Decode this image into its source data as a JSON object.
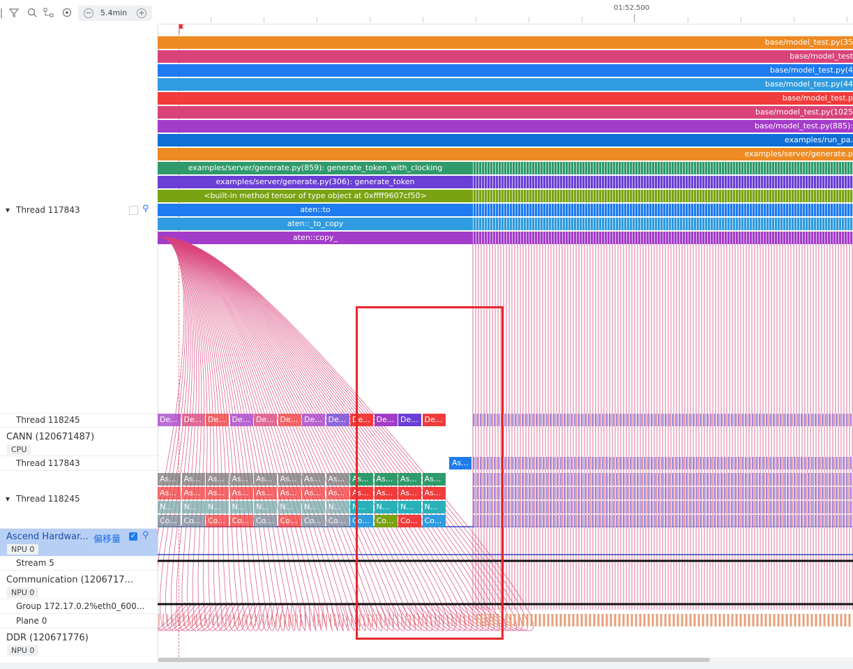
{
  "toolbar": {
    "zoom_value": "5.4min",
    "icons": [
      "filter-icon",
      "search-icon",
      "flow-icon",
      "target-icon"
    ]
  },
  "ruler": {
    "time_label": "01:52.500"
  },
  "rows": {
    "thread_117843": "Thread 117843",
    "thread_118245_a": "Thread 118245",
    "cann": "CANN (120671487)",
    "cann_badge": "CPU",
    "thread_117843_b": "Thread 117843",
    "thread_118245_b": "Thread 118245",
    "ascend": "Ascend Hardwar...",
    "ascend_offset": "偏移量",
    "ascend_badge": "NPU 0",
    "stream": "Stream 5",
    "comm": "Communication (1206717...",
    "comm_badge": "NPU 0",
    "group": "Group 172.17.0.2%eth0_600...",
    "plane": "Plane 0",
    "ddr": "DDR (120671776)",
    "ddr_badge": "NPU 0"
  },
  "stack": [
    {
      "label": "base/model_test.py(35",
      "color": "#ee8a22"
    },
    {
      "label": "base/model_test",
      "color": "#d9437a"
    },
    {
      "label": "base/model_test.py(4",
      "color": "#1e7bf0"
    },
    {
      "label": "base/model_test.py(44",
      "color": "#2f9be0"
    },
    {
      "label": "base/model_test.p",
      "color": "#f23b3b"
    },
    {
      "label": "base/model_test.py(1025",
      "color": "#d9437a"
    },
    {
      "label": "base/model_test.py(885):",
      "color": "#a33cc9"
    },
    {
      "label": "examples/run_pa.",
      "color": "#0f6fd6"
    },
    {
      "label": "examples/server/generate.p",
      "color": "#ee8a22"
    },
    {
      "label": "examples/server/generate.py(859): generate_token_with_clocking",
      "color": "#2f9a6a"
    },
    {
      "label": "examples/server/generate.py(306): generate_token",
      "color": "#6a3fd6"
    },
    {
      "label": "<built-in method tensor of type object at 0xffff9607cf50>",
      "color": "#79a312"
    },
    {
      "label": "aten::to",
      "color": "#1e7bf0"
    },
    {
      "label": "aten::_to_copy",
      "color": "#2f9be0"
    },
    {
      "label": "aten::copy_",
      "color": "#a33cc9"
    }
  ],
  "mini_slices": {
    "de": "De...",
    "as": "As...",
    "n": "N...",
    "co": "Co..."
  },
  "colors": {
    "highlight_box": "#e8262c",
    "flow_lines": "#d9437a",
    "row_highlight": "#b8cff5",
    "accent": "#1e7bf0"
  }
}
